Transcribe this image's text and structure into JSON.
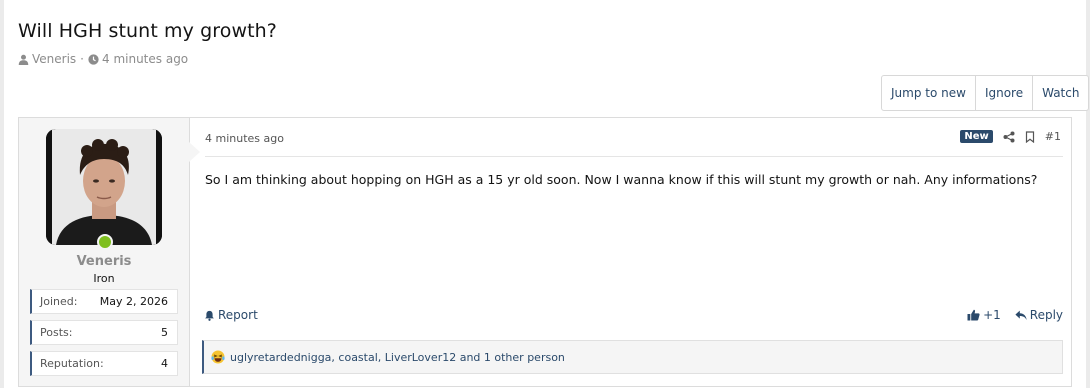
{
  "thread": {
    "title": "Will HGH stunt my growth?",
    "author": "Veneris",
    "meta_sep": "·",
    "age": "4 minutes ago"
  },
  "actions": {
    "jump_to_new": "Jump to new",
    "ignore": "Ignore",
    "watch": "Watch"
  },
  "post": {
    "date": "4 minutes ago",
    "new_badge": "New",
    "number": "#1",
    "message": "So I am thinking about hopping on HGH as a 15 yr old soon. Now I wanna know if this will stunt my growth or nah. Any informations?",
    "report": "Report",
    "like": "+1",
    "reply": "Reply",
    "reactions": "uglyretardednigga, coastal, LiverLover12 and 1 other person"
  },
  "user": {
    "name": "Veneris",
    "title": "Iron",
    "stats": [
      {
        "label": "Joined:",
        "value": "May 2, 2026"
      },
      {
        "label": "Posts:",
        "value": "5"
      },
      {
        "label": "Reputation:",
        "value": "4"
      }
    ]
  },
  "icons": {
    "user": "user-icon",
    "clock": "clock-icon",
    "share": "share-icon",
    "bookmark": "bookmark-icon",
    "report": "bell-icon",
    "like": "thumbs-up-icon",
    "reply": "reply-icon",
    "reaction": "laughing-emoji-icon"
  },
  "colors": {
    "accent": "#2b4a6b",
    "online": "#7fbf1f"
  }
}
